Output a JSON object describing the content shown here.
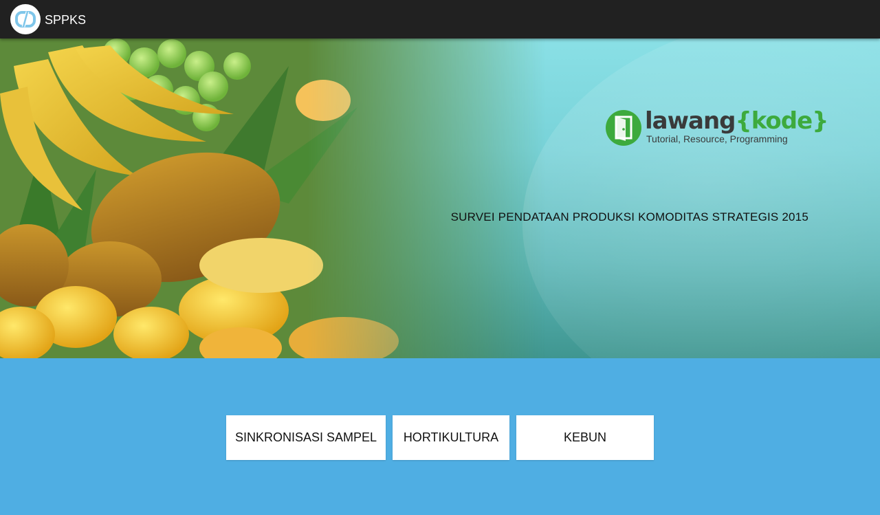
{
  "topbar": {
    "app_title": "SPPKS",
    "icon": "code-logo-icon"
  },
  "banner": {
    "logo": {
      "word": "lawang",
      "brace_open": "{",
      "brace_word": "kode",
      "brace_close": "}",
      "tagline": "Tutorial, Resource, Programming",
      "icon": "door-logo-icon"
    },
    "survey_title": "SURVEI PENDATAAN PRODUKSI KOMODITAS STRATEGIS 2015"
  },
  "buttons": {
    "sync": "SINKRONISASI SAMPEL",
    "horti": "HORTIKULTURA",
    "kebun": "KEBUN"
  },
  "colors": {
    "topbar": "#212121",
    "background": "#4faee3",
    "brand_green": "#3daa3d"
  }
}
